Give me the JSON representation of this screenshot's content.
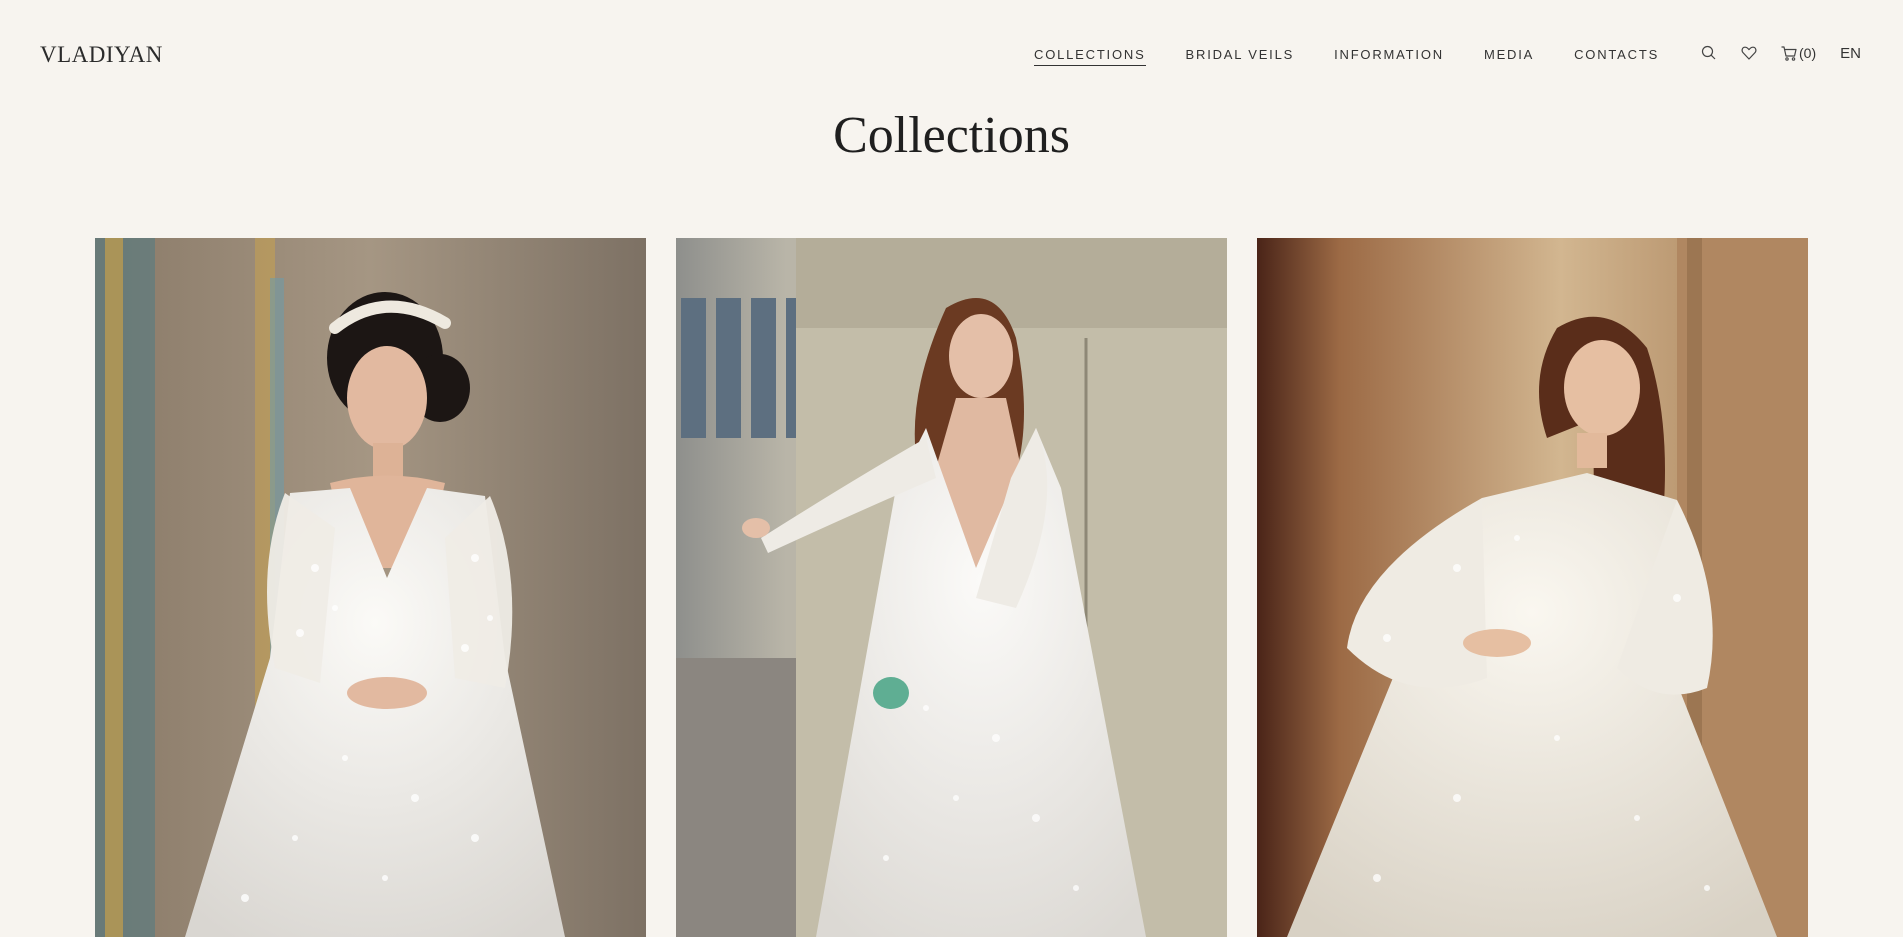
{
  "brand": {
    "logo_text": "VLADIYAN"
  },
  "nav": {
    "items": [
      {
        "label": "COLLECTIONS",
        "active": true
      },
      {
        "label": "BRIDAL VEILS",
        "active": false
      },
      {
        "label": "INFORMATION",
        "active": false
      },
      {
        "label": "MEDIA",
        "active": false
      },
      {
        "label": "CONTACTS",
        "active": false
      }
    ]
  },
  "utils": {
    "search_icon": "search-icon",
    "wishlist_icon": "heart-icon",
    "cart_icon": "cart-icon",
    "cart_count": "(0)",
    "language": "EN"
  },
  "main": {
    "title": "Collections",
    "cards": [
      {
        "image": "bride-ballgown-floral-lace-photo"
      },
      {
        "image": "bride-lace-long-sleeve-gown-photo"
      },
      {
        "image": "bride-lace-bishop-sleeve-gown-photo"
      }
    ]
  },
  "colors": {
    "background": "#f7f4ef",
    "text": "#222222"
  }
}
